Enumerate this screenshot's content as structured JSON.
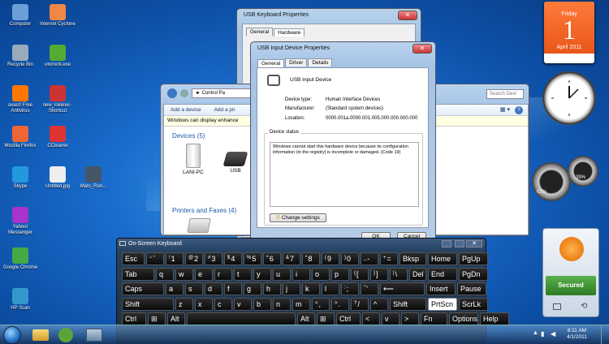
{
  "desktop_icons": [
    {
      "label": "Computer",
      "icon": "computer-icon"
    },
    {
      "label": "Internet Cyclone",
      "icon": "cyclone-icon"
    },
    {
      "label": "Recycle Bin",
      "icon": "recycle-bin-icon"
    },
    {
      "label": "utorrent.exe",
      "icon": "utorrent-icon"
    },
    {
      "label": "avast! Free Antivirus",
      "icon": "avast-icon"
    },
    {
      "label": "new_lokiexe - Shortcut",
      "icon": "exe-icon"
    },
    {
      "label": "Mozilla Firefox",
      "icon": "firefox-icon"
    },
    {
      "label": "CCleaner",
      "icon": "ccleaner-icon"
    },
    {
      "label": "Skype",
      "icon": "skype-icon"
    },
    {
      "label": "Untitled.jpg",
      "icon": "image-icon"
    },
    {
      "label": "Mats_Run...",
      "icon": "user-icon"
    },
    {
      "label": "Yahoo! Messenger",
      "icon": "yahoo-icon"
    },
    {
      "label": "Google Chrome",
      "icon": "chrome-icon"
    },
    {
      "label": "HP Scan",
      "icon": "scanner-icon"
    }
  ],
  "keyboard_props": {
    "title": "USB Keyboard Properties",
    "tabs": [
      "General",
      "Hardware"
    ]
  },
  "device_props": {
    "title": "USB Input Device Properties",
    "tabs": [
      "General",
      "Driver",
      "Details"
    ],
    "device_name": "USB Input Device",
    "fields": [
      {
        "label": "Device type:",
        "value": "Human Interface Devices"
      },
      {
        "label": "Manufacturer:",
        "value": "(Standard system devices)"
      },
      {
        "label": "Location:",
        "value": "0000.001a.0000.001.005.000.000.000.000"
      }
    ],
    "status_label": "Device status",
    "status_text": "Windows cannot start this hardware device because its configuration information (in the registry) is incomplete or damaged. (Code 19)",
    "change_settings": "Change settings",
    "ok": "OK",
    "cancel": "Cancel"
  },
  "explorer": {
    "breadcrumb": "Control Pa",
    "search_placeholder": "Search Devi",
    "add_device": "Add a device",
    "add_printer": "Add a pri",
    "info_bar": "Windows can display enhance",
    "devices_header": "Devices (5)",
    "device_items": [
      "LANI-PC",
      "USB"
    ],
    "printers_header": "Printers and Faxes (4)"
  },
  "osk": {
    "title": "On-Screen Keyboard",
    "rows": [
      [
        {
          "t": "Esc",
          "w": 28
        },
        {
          "s": "~",
          "t": "`",
          "w": 22
        },
        {
          "s": "!",
          "t": "1",
          "w": 22
        },
        {
          "s": "@",
          "t": "2",
          "w": 22
        },
        {
          "s": "#",
          "t": "3",
          "w": 22
        },
        {
          "s": "$",
          "t": "4",
          "w": 22
        },
        {
          "s": "%",
          "t": "5",
          "w": 22
        },
        {
          "s": "^",
          "t": "6",
          "w": 22
        },
        {
          "s": "&",
          "t": "7",
          "w": 22
        },
        {
          "s": "*",
          "t": "8",
          "w": 22
        },
        {
          "s": "(",
          "t": "9",
          "w": 22
        },
        {
          "s": ")",
          "t": "0",
          "w": 22
        },
        {
          "s": "_",
          "t": "-",
          "w": 22
        },
        {
          "s": "+",
          "t": "=",
          "w": 22
        },
        {
          "t": "Bksp",
          "w": 33
        },
        {
          "t": "Home",
          "w": 36
        },
        {
          "t": "PgUp",
          "w": 36
        }
      ],
      [
        {
          "t": "Tab",
          "w": 40
        },
        {
          "t": "q",
          "w": 22
        },
        {
          "t": "w",
          "w": 22
        },
        {
          "t": "e",
          "w": 22
        },
        {
          "t": "r",
          "w": 22
        },
        {
          "t": "t",
          "w": 22
        },
        {
          "t": "y",
          "w": 22
        },
        {
          "t": "u",
          "w": 22
        },
        {
          "t": "i",
          "w": 22
        },
        {
          "t": "o",
          "w": 22
        },
        {
          "t": "p",
          "w": 22
        },
        {
          "s": "{",
          "t": "[",
          "w": 22
        },
        {
          "s": "}",
          "t": "]",
          "w": 22
        },
        {
          "s": "|",
          "t": "\\",
          "w": 22
        },
        {
          "t": "Del",
          "w": 21
        },
        {
          "t": "End",
          "w": 36
        },
        {
          "t": "PgDn",
          "w": 36
        }
      ],
      [
        {
          "t": "Caps",
          "w": 52
        },
        {
          "t": "a",
          "w": 22
        },
        {
          "t": "s",
          "w": 22
        },
        {
          "t": "d",
          "w": 22
        },
        {
          "t": "f",
          "w": 22
        },
        {
          "t": "g",
          "w": 22
        },
        {
          "t": "h",
          "w": 22
        },
        {
          "t": "j",
          "w": 22
        },
        {
          "t": "k",
          "w": 22
        },
        {
          "t": "l",
          "w": 22
        },
        {
          "s": ":",
          "t": ";",
          "w": 22
        },
        {
          "s": "\"",
          "t": "'",
          "w": 22
        },
        {
          "t": "⟵",
          "w": 55
        },
        {
          "t": "Insert",
          "w": 36
        },
        {
          "t": "Pause",
          "w": 36
        }
      ],
      [
        {
          "t": "Shift",
          "w": 64
        },
        {
          "t": "z",
          "w": 22
        },
        {
          "t": "x",
          "w": 22
        },
        {
          "t": "c",
          "w": 22
        },
        {
          "t": "v",
          "w": 22
        },
        {
          "t": "b",
          "w": 22
        },
        {
          "t": "n",
          "w": 22
        },
        {
          "t": "m",
          "w": 22
        },
        {
          "s": "<",
          "t": ",",
          "w": 22
        },
        {
          "s": ">",
          "t": ".",
          "w": 22
        },
        {
          "s": "?",
          "t": "/",
          "w": 22
        },
        {
          "t": "^",
          "w": 22
        },
        {
          "t": "Shift",
          "w": 45
        },
        {
          "t": "PrtScn",
          "w": 36,
          "hl": true
        },
        {
          "t": "ScrLk",
          "w": 36
        }
      ],
      [
        {
          "t": "Ctrl",
          "w": 30
        },
        {
          "t": "⊞",
          "w": 22
        },
        {
          "t": "Alt",
          "w": 22
        },
        {
          "t": "",
          "w": 134
        },
        {
          "t": "Alt",
          "w": 22
        },
        {
          "t": "⊞",
          "w": 22
        },
        {
          "t": "Ctrl",
          "w": 30
        },
        {
          "t": "<",
          "w": 22
        },
        {
          "t": "v",
          "w": 22
        },
        {
          "t": ">",
          "w": 22
        },
        {
          "t": "Fn",
          "w": 33
        },
        {
          "t": "Options",
          "w": 36
        },
        {
          "t": "Help",
          "w": 36
        }
      ]
    ]
  },
  "calendar": {
    "day": "Friday",
    "date": "1",
    "month": "April 2011"
  },
  "meter": {
    "cpu": "02%",
    "mem": "39%"
  },
  "avast": {
    "status": "Secured"
  },
  "clock": {
    "time": "8:11 AM",
    "date": "4/1/2011"
  }
}
